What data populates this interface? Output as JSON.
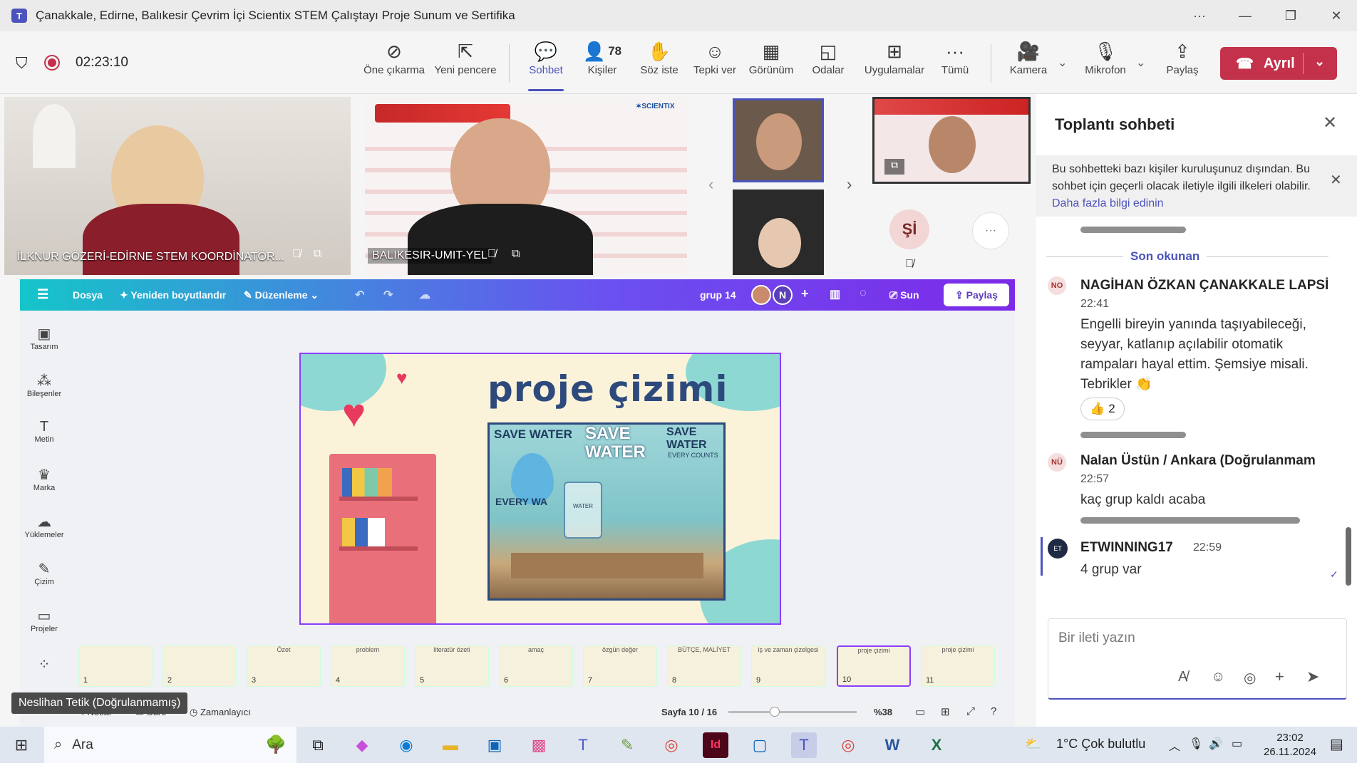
{
  "window": {
    "title": "Çanakkale, Edirne, Balıkesir Çevrim İçi Scientix STEM Çalıştayı Proje Sunum ve Sertifika"
  },
  "toolbar": {
    "timer": "02:23:10",
    "buttons": [
      {
        "label": "Öne çıkarma"
      },
      {
        "label": "Yeni pencere"
      },
      {
        "label": "Sohbet"
      },
      {
        "label": "Kişiler"
      },
      {
        "label": "Söz iste"
      },
      {
        "label": "Tepki ver"
      },
      {
        "label": "Görünüm"
      },
      {
        "label": "Odalar"
      },
      {
        "label": "Uygulamalar"
      },
      {
        "label": "Tümü"
      },
      {
        "label": "Kamera"
      },
      {
        "label": "Mikrofon"
      },
      {
        "label": "Paylaş"
      }
    ],
    "people_count": "78",
    "leave_label": "Ayrıl"
  },
  "videos": {
    "v1_label": "İLKNUR GÖZERİ-EDİRNE STEM KOORDİNATÖR...",
    "v2_label": "BALIKESIR-UMIT-YEL",
    "si_initials": "Şİ",
    "more": "···"
  },
  "chat": {
    "title": "Toplantı sohbeti",
    "notice": "Bu sohbetteki bazı kişiler kuruluşunuz dışından. Bu sohbet için geçerli olacak iletiyle ilgili ilkeleri olabilir.",
    "notice_link": "Daha fazla bilgi edinin",
    "last_read": "Son okunan",
    "messages": [
      {
        "initials": "NO",
        "name": "NAGİHAN ÖZKAN ÇANAKKALE LAPSİ",
        "time": "22:41",
        "text": "Engelli bireyin yanında taşıyabileceği, seyyar, katlanıp açılabilir otomatik rampaları hayal ettim. Şemsiye misali. Tebrikler 👏",
        "reaction": "👍 2"
      },
      {
        "initials": "NÜ",
        "name": "Nalan Üstün / Ankara (Doğrulanmam",
        "time": "22:57",
        "text": "kaç grup kaldı acaba"
      },
      {
        "initials": "ET",
        "name": "ETWINNING17",
        "time": "22:59",
        "text": "4 grup var"
      }
    ],
    "input_placeholder": "Bir ileti yazın"
  },
  "canva": {
    "menu": [
      "Dosya",
      "Yeniden boyutlandır",
      "Düzenleme"
    ],
    "group": "grup 14",
    "avatar_letter": "N",
    "present_label": "Sun",
    "share_label": "Paylaş",
    "sidebar": [
      "Tasarım",
      "Bileşenler",
      "Metin",
      "Marka",
      "Yüklemeler",
      "Çizim",
      "Projeler"
    ],
    "slide_title": "proje çizimi",
    "slide_image_texts": [
      "SAVE WATER",
      "SAVE WATER",
      "SAVE WATER",
      "EVERY COUNTS",
      "EVERY WA",
      "WATER"
    ],
    "thumbnails": [
      {
        "n": "1",
        "t": ""
      },
      {
        "n": "2",
        "t": ""
      },
      {
        "n": "3",
        "t": "Özet"
      },
      {
        "n": "4",
        "t": "problem"
      },
      {
        "n": "5",
        "t": "literatür özeti"
      },
      {
        "n": "6",
        "t": "amaç"
      },
      {
        "n": "7",
        "t": "özgün değer"
      },
      {
        "n": "8",
        "t": "BÜTÇE, MALİYET"
      },
      {
        "n": "9",
        "t": "iş ve zaman çizelgesi"
      },
      {
        "n": "10",
        "t": "proje çizimi"
      },
      {
        "n": "11",
        "t": "proje çizimi"
      }
    ],
    "bottom": {
      "notes": "Notlar",
      "duration": "Süre",
      "timer": "Zamanlayıcı",
      "page": "Sayfa 10 / 16",
      "zoom": "%38"
    },
    "hover_name": "Neslihan Tetik (Doğrulanmamış)"
  },
  "taskbar": {
    "search": "Ara",
    "weather": "1°C  Çok bulutlu",
    "time": "23:02",
    "date": "26.11.2024"
  },
  "colors": {
    "teams_purple": "#4b53bc",
    "leave_red": "#c4314b"
  }
}
